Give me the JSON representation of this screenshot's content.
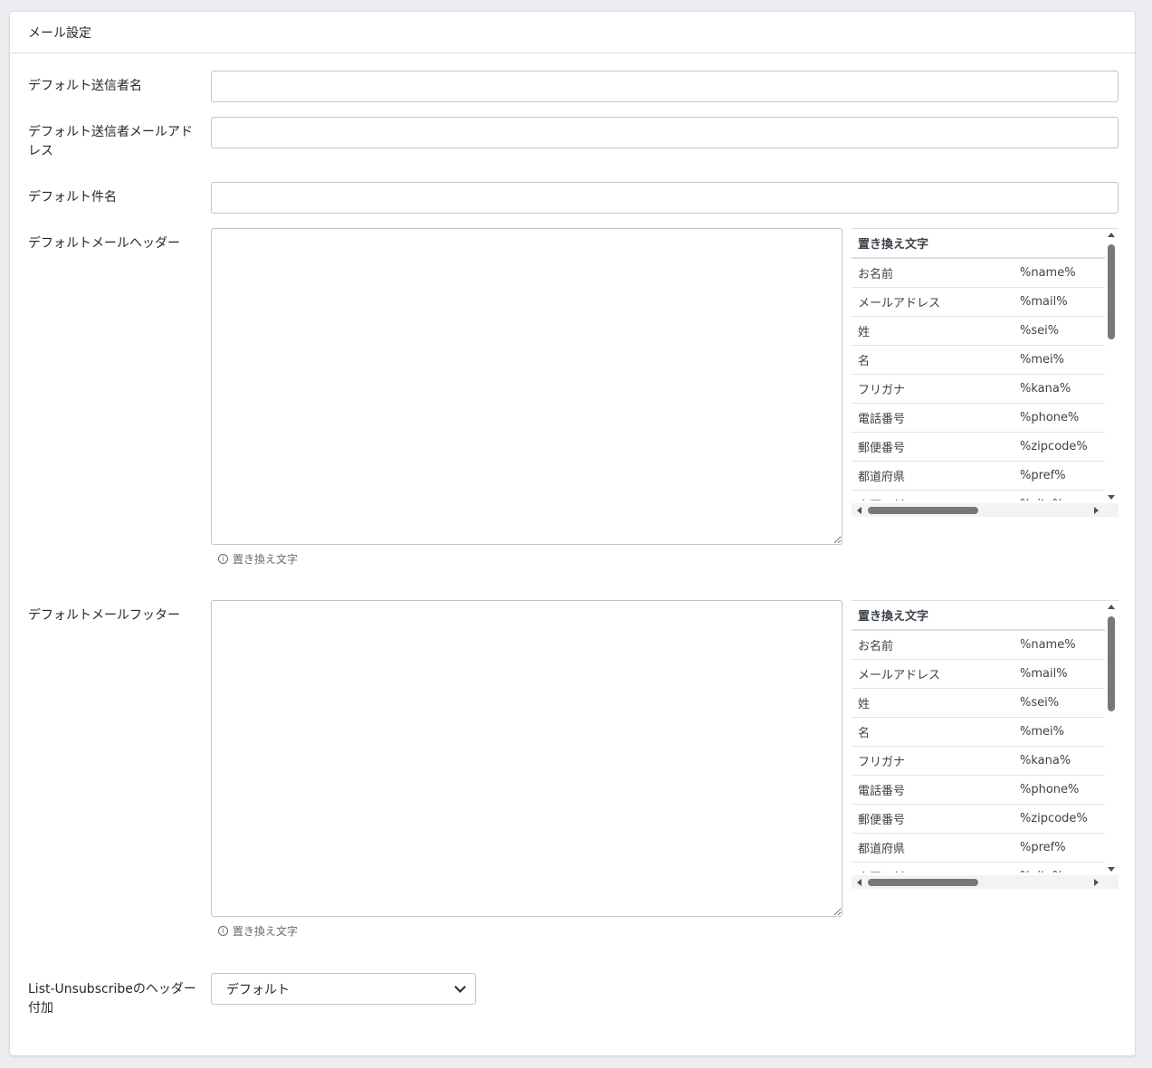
{
  "card": {
    "title": "メール設定"
  },
  "fields": {
    "sender_name": {
      "label": "デフォルト送信者名",
      "value": ""
    },
    "sender_email": {
      "label": "デフォルト送信者メールアドレス",
      "value": ""
    },
    "subject": {
      "label": "デフォルト件名",
      "value": ""
    },
    "header": {
      "label": "デフォルトメールヘッダー",
      "value": ""
    },
    "footer": {
      "label": "デフォルトメールフッター",
      "value": ""
    },
    "unsubscribe": {
      "label": "List-Unsubscribeのヘッダー付加",
      "selected": "デフォルト"
    }
  },
  "replacement": {
    "title": "置き換え文字",
    "help": "置き換え文字",
    "rows": [
      {
        "name": "お名前",
        "code": "%name%"
      },
      {
        "name": "メールアドレス",
        "code": "%mail%"
      },
      {
        "name": "姓",
        "code": "%sei%"
      },
      {
        "name": "名",
        "code": "%mei%"
      },
      {
        "name": "フリガナ",
        "code": "%kana%"
      },
      {
        "name": "電話番号",
        "code": "%phone%"
      },
      {
        "name": "郵便番号",
        "code": "%zipcode%"
      },
      {
        "name": "都道府県",
        "code": "%pref%"
      },
      {
        "name": "市区町村",
        "code": "%city%"
      }
    ]
  }
}
